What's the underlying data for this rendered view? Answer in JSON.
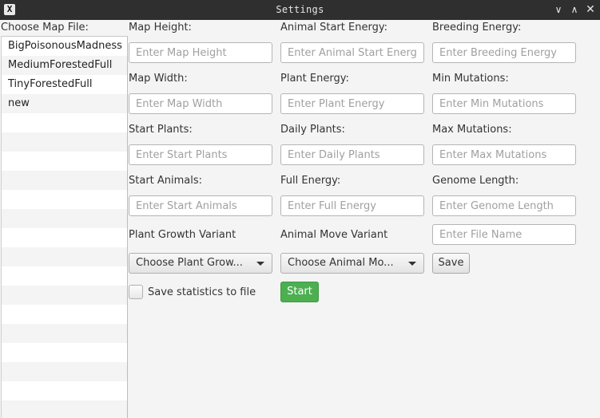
{
  "window": {
    "title": "Settings",
    "app_icon": "x-app-icon",
    "controls": {
      "minimize": "∨",
      "maximize": "∧",
      "close": "✕"
    }
  },
  "map_list": {
    "label": "Choose Map File:",
    "items": [
      "BigPoisonousMadness",
      "MediumForestedFull",
      "TinyForestedFull",
      "new",
      "",
      "",
      "",
      "",
      "",
      "",
      "",
      "",
      "",
      "",
      "",
      "",
      "",
      "",
      "",
      ""
    ]
  },
  "form": {
    "map_height": {
      "label": "Map Height:",
      "placeholder": "Enter Map Height"
    },
    "map_width": {
      "label": "Map Width:",
      "placeholder": "Enter Map Width"
    },
    "start_plants": {
      "label": "Start Plants:",
      "placeholder": "Enter Start Plants"
    },
    "start_animals": {
      "label": "Start Animals:",
      "placeholder": "Enter Start Animals"
    },
    "animal_start_energy": {
      "label": "Animal Start Energy:",
      "placeholder": "Enter Animal Start Energy"
    },
    "plant_energy": {
      "label": "Plant Energy:",
      "placeholder": "Enter Plant Energy"
    },
    "daily_plants": {
      "label": "Daily Plants:",
      "placeholder": "Enter Daily Plants"
    },
    "full_energy": {
      "label": "Full Energy:",
      "placeholder": "Enter Full Energy"
    },
    "breeding_energy": {
      "label": "Breeding Energy:",
      "placeholder": "Enter Breeding Energy"
    },
    "min_mutations": {
      "label": "Min Mutations:",
      "placeholder": "Enter Min Mutations"
    },
    "max_mutations": {
      "label": "Max Mutations:",
      "placeholder": "Enter Max Mutations"
    },
    "genome_length": {
      "label": "Genome Length:",
      "placeholder": "Enter Genome Length"
    },
    "file_name": {
      "placeholder": "Enter File Name"
    },
    "plant_growth_variant": {
      "label": "Plant Growth Variant",
      "selected": "Choose Plant Grow..."
    },
    "animal_move_variant": {
      "label": "Animal Move Variant",
      "selected": "Choose Animal Mo..."
    },
    "save_label": "Save",
    "save_statistics_label": "Save statistics to file",
    "save_statistics_checked": false,
    "start_label": "Start"
  },
  "colors": {
    "title_bar": "#2f2f2f",
    "start_button": "#4caf50",
    "background": "#f4f4f4"
  }
}
